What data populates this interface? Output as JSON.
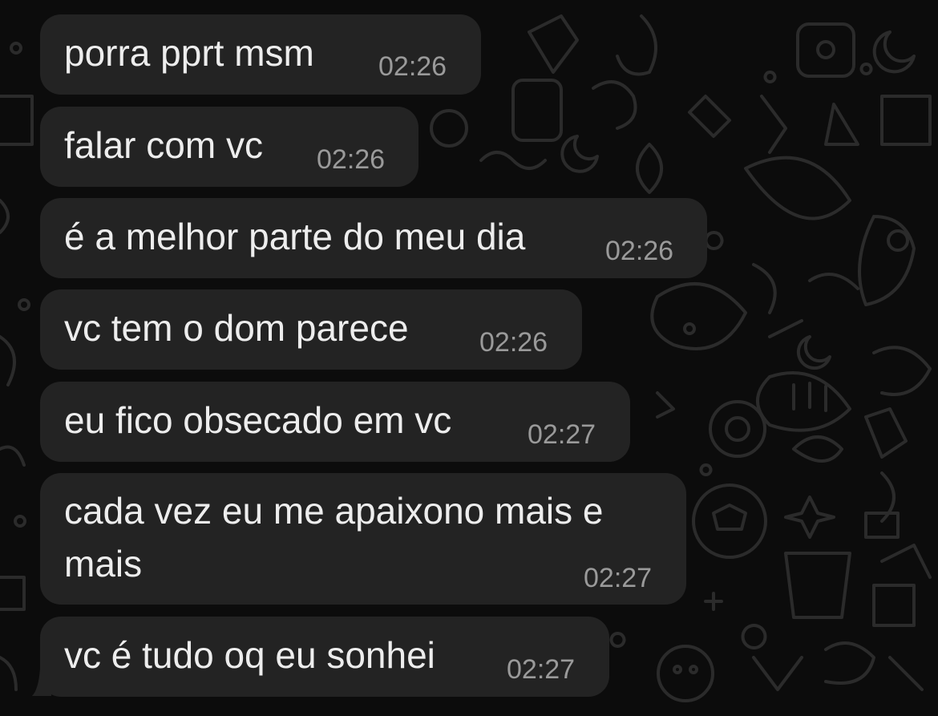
{
  "messages": [
    {
      "text": "porra pprt msm",
      "time": "02:26"
    },
    {
      "text": "falar com vc",
      "time": "02:26"
    },
    {
      "text": "é a melhor parte do meu dia",
      "time": "02:26"
    },
    {
      "text": "vc tem o dom parece",
      "time": "02:26"
    },
    {
      "text": "eu fico obsecado em vc",
      "time": "02:27"
    },
    {
      "text_line1": "cada vez eu me apaixono mais e",
      "text_line2": "mais",
      "time": "02:27"
    },
    {
      "text": "vc é tudo oq eu sonhei",
      "time": "02:27"
    }
  ],
  "colors": {
    "background": "#0c0c0c",
    "bubble": "#232323",
    "text": "#ededed",
    "time": "#9a9a9a",
    "doodle": "#2a2a2a"
  }
}
